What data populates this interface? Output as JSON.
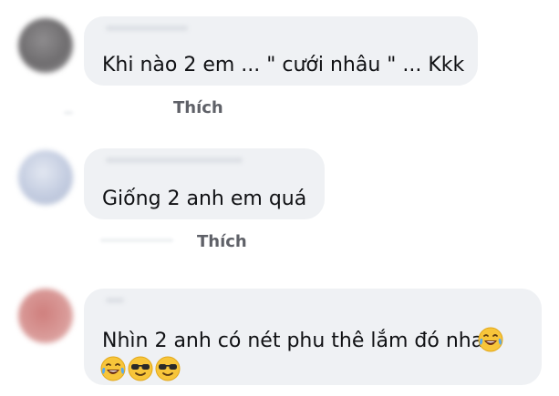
{
  "comments": [
    {
      "text": "Khi nào 2 em ... \" cưới nhâu \" ... Kkk",
      "like_label": "Thích",
      "avatar_color": "#7d7b7d"
    },
    {
      "text": "Giống 2 anh em quá",
      "like_label": "Thích",
      "avatar_color": "#c7d0e3"
    },
    {
      "text": "Nhìn 2 anh có nét phu thê lắm đó nha",
      "like_label": "",
      "avatar_color": "#d99a98",
      "emojis": [
        "laughing-tears",
        "cool-sunglasses",
        "cool-sunglasses"
      ]
    }
  ],
  "colors": {
    "bubble_bg": "#eff1f4",
    "text": "#101114",
    "action_text": "#5f6168",
    "emoji_yellow": "#f7c53a"
  }
}
